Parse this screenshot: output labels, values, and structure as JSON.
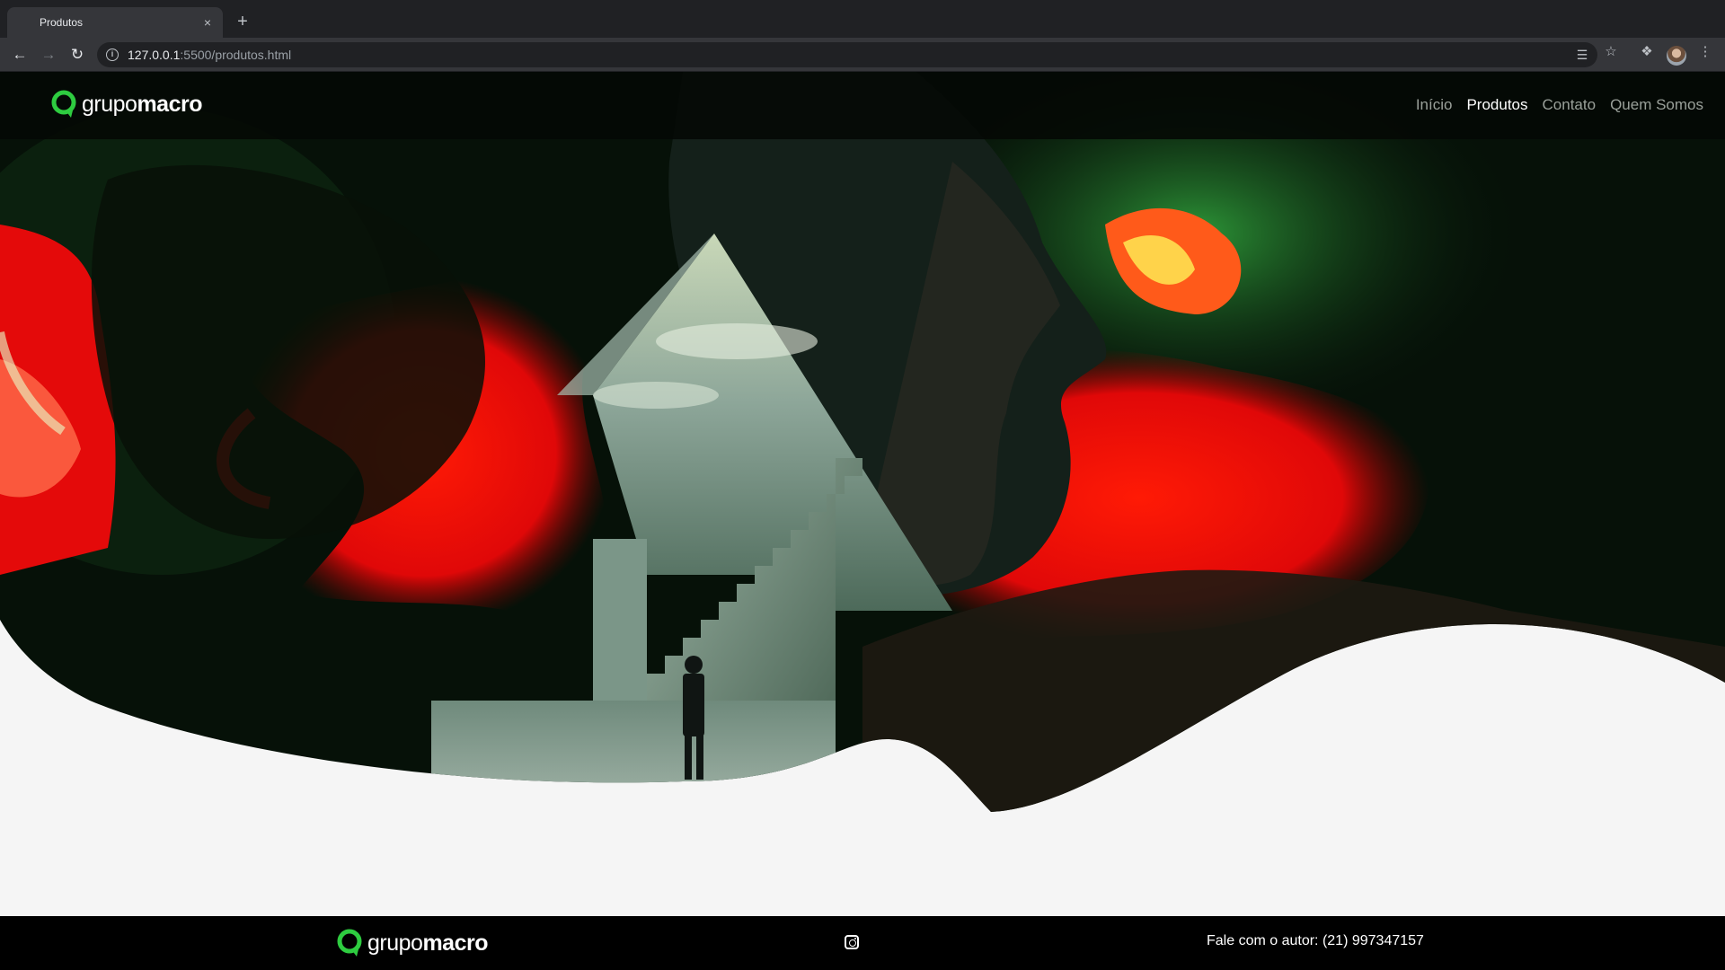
{
  "browser": {
    "tab_title": "Produtos",
    "tab_close": "×",
    "new_tab": "+",
    "url_host": "127.0.0.1",
    "url_rest": ":5500/produtos.html",
    "icons": [
      "back-icon",
      "forward-icon",
      "reload-icon",
      "info-icon",
      "translate-icon",
      "star-icon",
      "extensions-icon",
      "profile-avatar",
      "menu-icon"
    ]
  },
  "site": {
    "brand_light": "grupo",
    "brand_bold": "macro",
    "brand_color": "#2ecc40",
    "nav": [
      {
        "label": "Início",
        "active": false
      },
      {
        "label": "Produtos",
        "active": true
      },
      {
        "label": "Contato",
        "active": false
      },
      {
        "label": "Quem Somos",
        "active": false
      }
    ]
  },
  "footer": {
    "brand_light": "grupo",
    "brand_bold": "macro",
    "social_icon": "instagram-icon",
    "contact": "Fale com o autor: (21) 997347157"
  }
}
